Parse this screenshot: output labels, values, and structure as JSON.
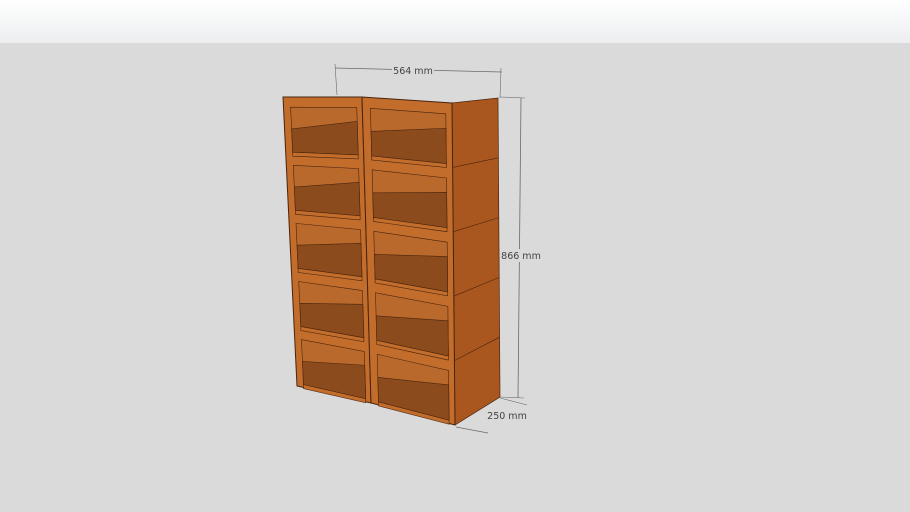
{
  "model": {
    "name": "double cubby bookshelf",
    "columns": 2,
    "rows": 5,
    "colors": {
      "front": "#c26d2c",
      "side": "#a9571f",
      "back": "#b9692b",
      "shelf": "#8c4b1d",
      "edge": "#4a240c",
      "dimension": "#6a6a6a"
    }
  },
  "dimensions": {
    "width": "564 mm",
    "height": "866 mm",
    "depth": "250 mm"
  }
}
